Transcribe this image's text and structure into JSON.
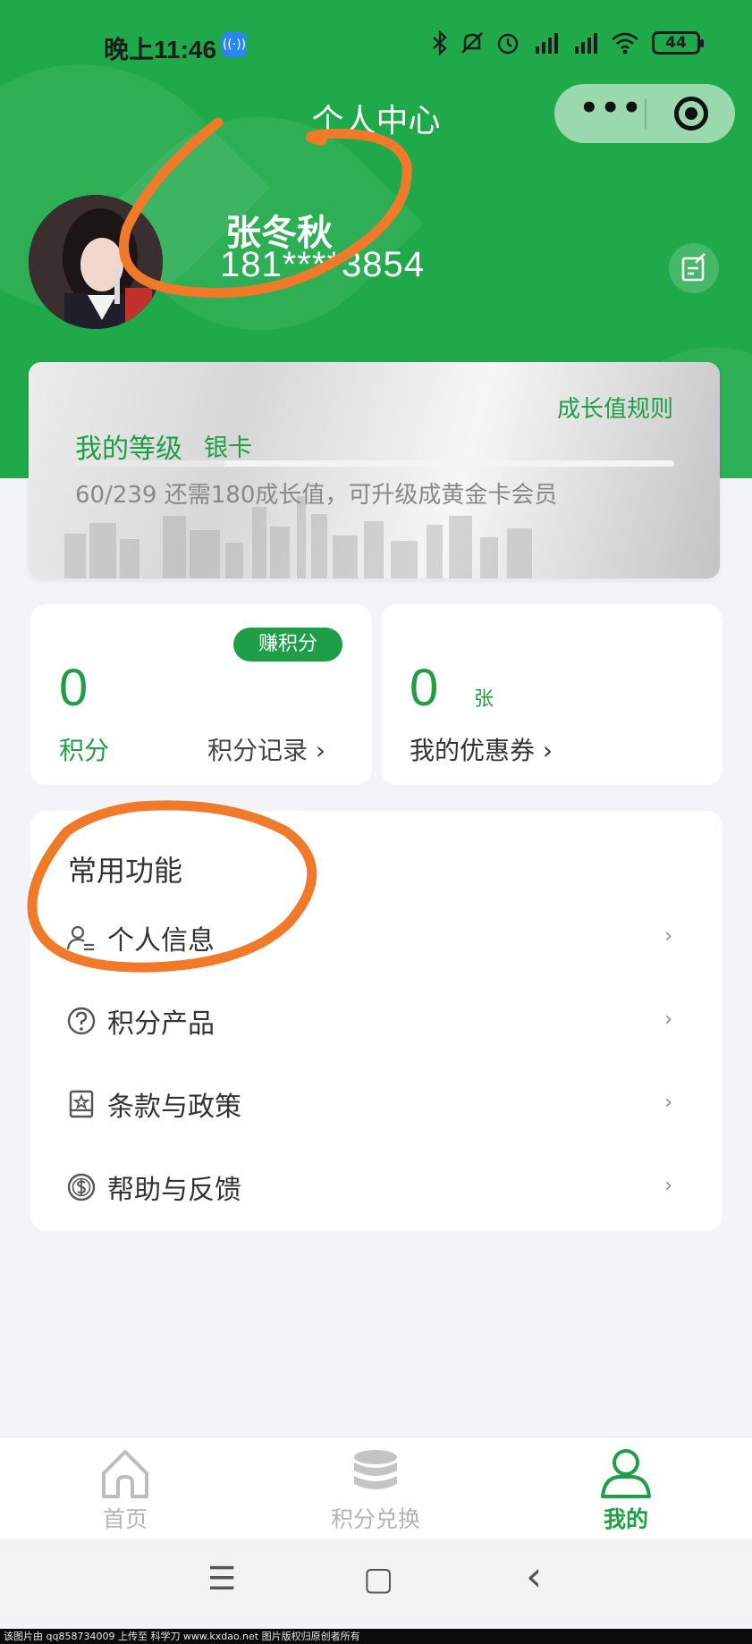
{
  "status_bar": {
    "time": "晚上11:46",
    "badge": "((·))",
    "battery": "44",
    "icons": [
      "bluetooth-icon",
      "mute-icon",
      "alarm-icon",
      "signal-hd-icon",
      "signal-hd-icon",
      "wifi-icon",
      "battery-icon"
    ]
  },
  "nav": {
    "title": "个人中心",
    "menu_label": "•••"
  },
  "profile": {
    "name": "张冬秋",
    "phone": "181****3854"
  },
  "level_card": {
    "rules_link": "成长值规则",
    "label": "我的等级",
    "level": "银卡",
    "progress_text": "60/239 还需180成长值，可升级成黄金卡会员",
    "progress": 0.25
  },
  "points_card": {
    "earn_button": "赚积分",
    "value": "0",
    "label": "积分",
    "link": "积分记录"
  },
  "coupon_card": {
    "value": "0",
    "unit": "张",
    "link": "我的优惠券"
  },
  "functions": {
    "title": "常用功能",
    "items": [
      {
        "label": "个人信息",
        "icon": "user-list-icon"
      },
      {
        "label": "积分产品",
        "icon": "question-circle-icon"
      },
      {
        "label": "条款与政策",
        "icon": "document-star-icon"
      },
      {
        "label": "帮助与反馈",
        "icon": "dollar-circle-icon"
      }
    ],
    "arrow": "›"
  },
  "tabbar": {
    "tabs": [
      {
        "label": "首页",
        "icon": "home-icon",
        "active": false
      },
      {
        "label": "积分兑换",
        "icon": "coins-stack-icon",
        "active": false
      },
      {
        "label": "我的",
        "icon": "user-icon",
        "active": true
      }
    ]
  },
  "system_nav": {
    "menu": "☰",
    "home": "▢",
    "back": "‹"
  },
  "footer": {
    "text": "该图片由 qq858734009 上传至 科学刀 www.kxdao.net 图片版权归原创者所有"
  },
  "colors": {
    "brand_green": "#1fa94a",
    "accent_green": "#1e9e46",
    "annotation_orange": "#f07a2a"
  }
}
